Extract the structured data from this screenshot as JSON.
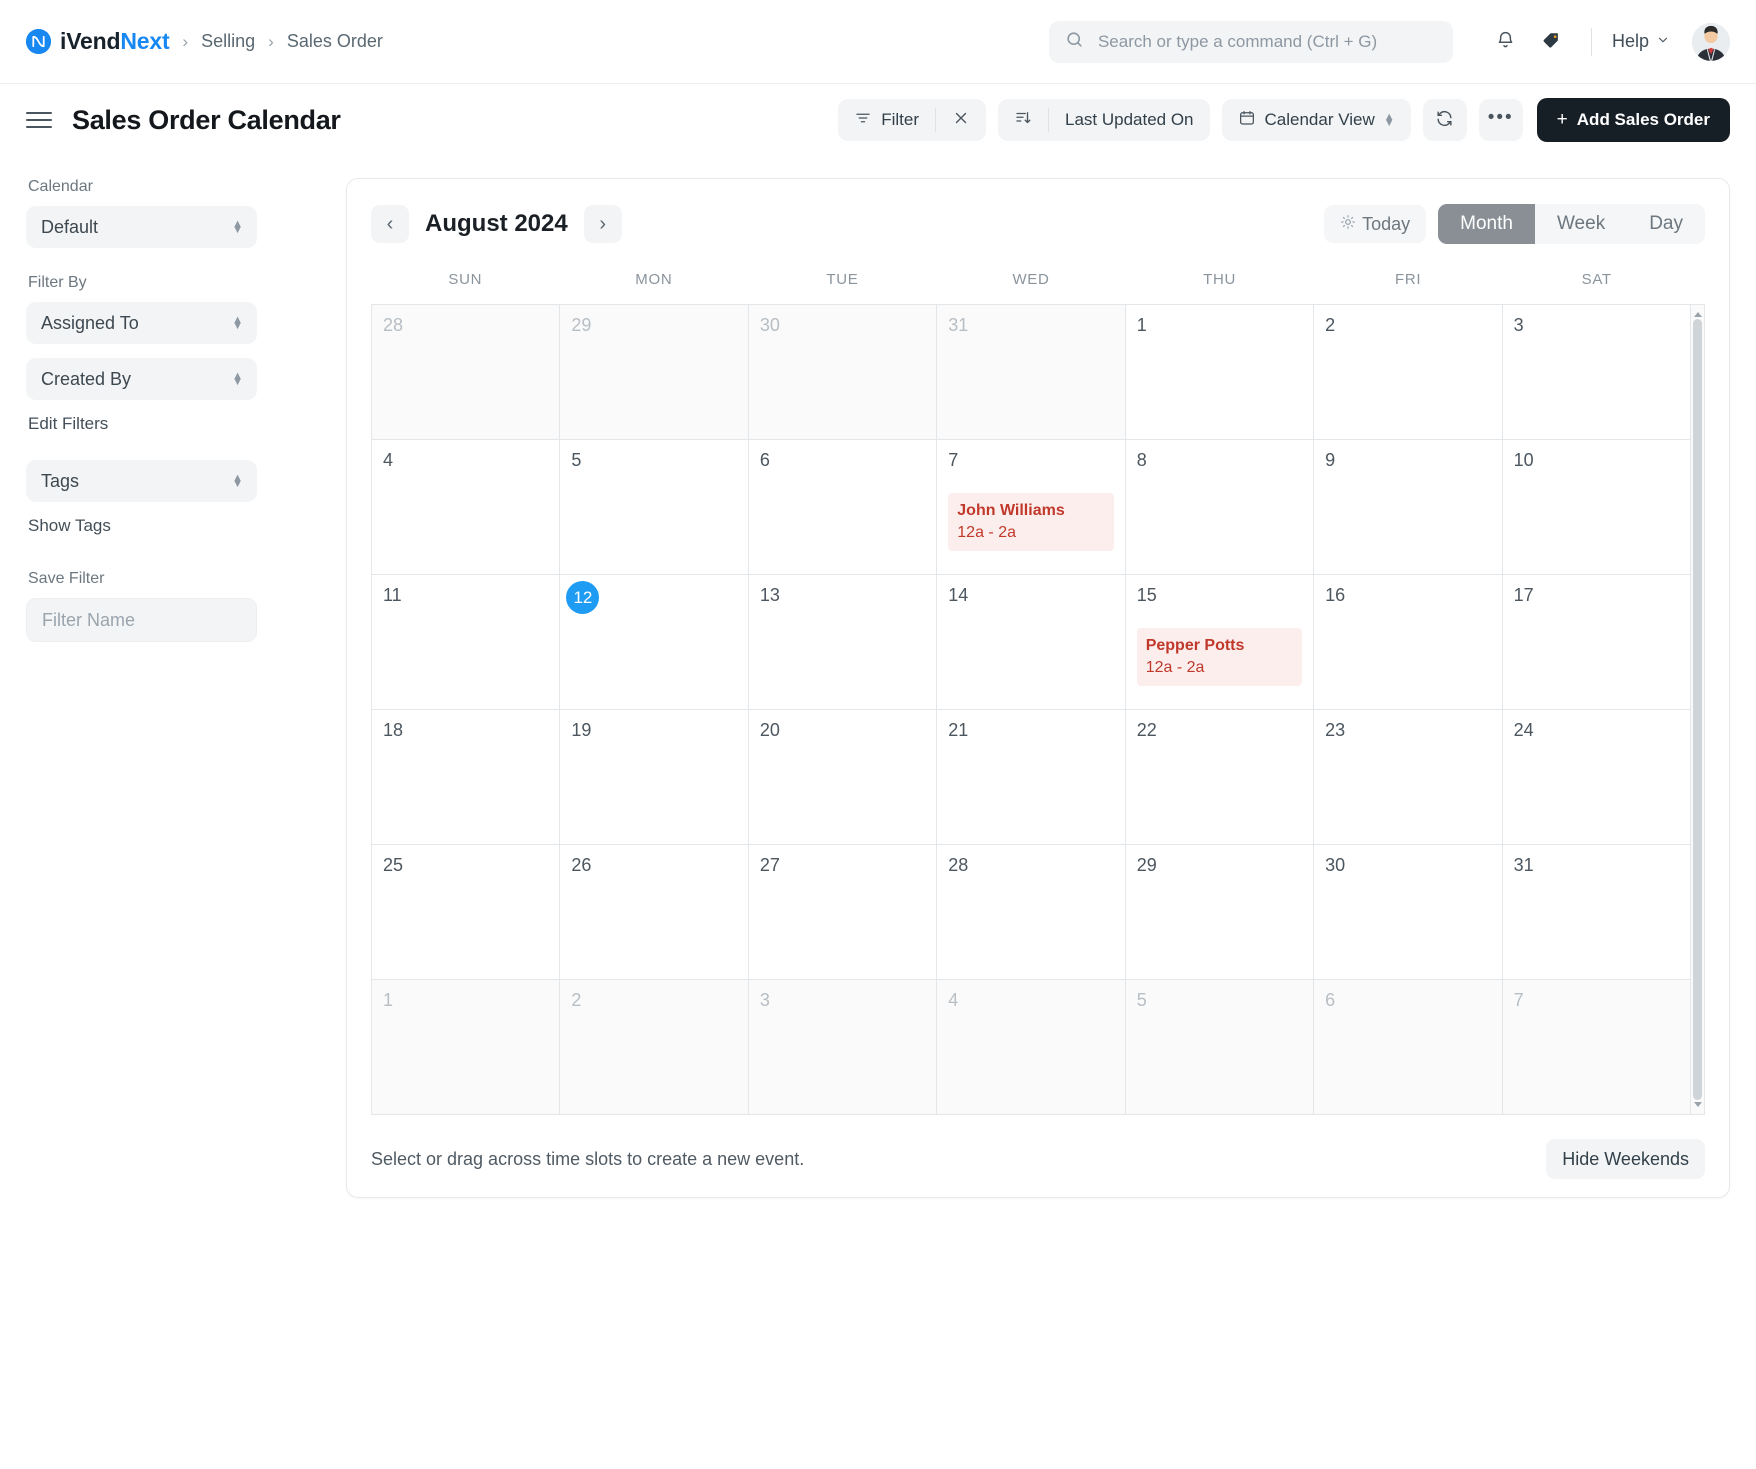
{
  "navbar": {
    "brand_first": "iVend",
    "brand_second": "Next",
    "breadcrumbs": [
      "Selling",
      "Sales Order"
    ],
    "search_placeholder": "Search or type a command (Ctrl + G)",
    "search_value": "",
    "help_label": "Help",
    "notification_icon": "bell-icon",
    "tag_icon": "tag-icon",
    "avatar_icon": "user-avatar"
  },
  "page_header": {
    "title": "Sales Order Calendar",
    "filter_label": "Filter",
    "filter_clear_label": "×",
    "sort_label": "Last Updated On",
    "view_label": "Calendar View",
    "refresh_icon": "refresh-icon",
    "more_label": "•••",
    "add_label": "Add Sales Order",
    "add_plus": "+"
  },
  "sidebar": {
    "calendar_label": "Calendar",
    "calendar_value": "Default",
    "filter_by_label": "Filter By",
    "assigned_to_value": "Assigned To",
    "created_by_value": "Created By",
    "edit_filters_label": "Edit Filters",
    "tags_value": "Tags",
    "show_tags_label": "Show Tags",
    "save_filter_label": "Save Filter",
    "filter_name_placeholder": "Filter Name",
    "filter_name_value": ""
  },
  "calendar": {
    "title": "August 2024",
    "prev_label": "‹",
    "next_label": "›",
    "today_label": "Today",
    "views": [
      {
        "label": "Month",
        "active": true
      },
      {
        "label": "Week",
        "active": false
      },
      {
        "label": "Day",
        "active": false
      }
    ],
    "weekdays": [
      "SUN",
      "MON",
      "TUE",
      "WED",
      "THU",
      "FRI",
      "SAT"
    ],
    "footer_hint": "Select or drag across time slots to create a new event.",
    "hide_weekends_label": "Hide Weekends",
    "today_date": 12,
    "accent_today_color": "#1e9cf3",
    "event_bg_color": "#fdeeee",
    "event_text_color": "#c0392b",
    "weeks": [
      [
        {
          "day": "28",
          "other": true,
          "events": []
        },
        {
          "day": "29",
          "other": true,
          "events": []
        },
        {
          "day": "30",
          "other": true,
          "events": []
        },
        {
          "day": "31",
          "other": true,
          "events": []
        },
        {
          "day": "1",
          "other": false,
          "events": []
        },
        {
          "day": "2",
          "other": false,
          "events": []
        },
        {
          "day": "3",
          "other": false,
          "events": []
        }
      ],
      [
        {
          "day": "4",
          "other": false,
          "events": []
        },
        {
          "day": "5",
          "other": false,
          "events": []
        },
        {
          "day": "6",
          "other": false,
          "events": []
        },
        {
          "day": "7",
          "other": false,
          "events": [
            {
              "name": "John Williams",
              "time": "12a - 2a"
            }
          ]
        },
        {
          "day": "8",
          "other": false,
          "events": []
        },
        {
          "day": "9",
          "other": false,
          "events": []
        },
        {
          "day": "10",
          "other": false,
          "events": []
        }
      ],
      [
        {
          "day": "11",
          "other": false,
          "events": []
        },
        {
          "day": "12",
          "other": false,
          "today": true,
          "events": []
        },
        {
          "day": "13",
          "other": false,
          "events": []
        },
        {
          "day": "14",
          "other": false,
          "events": []
        },
        {
          "day": "15",
          "other": false,
          "events": [
            {
              "name": "Pepper Potts",
              "time": "12a - 2a"
            }
          ]
        },
        {
          "day": "16",
          "other": false,
          "events": []
        },
        {
          "day": "17",
          "other": false,
          "events": []
        }
      ],
      [
        {
          "day": "18",
          "other": false,
          "events": []
        },
        {
          "day": "19",
          "other": false,
          "events": []
        },
        {
          "day": "20",
          "other": false,
          "events": []
        },
        {
          "day": "21",
          "other": false,
          "events": []
        },
        {
          "day": "22",
          "other": false,
          "events": []
        },
        {
          "day": "23",
          "other": false,
          "events": []
        },
        {
          "day": "24",
          "other": false,
          "events": []
        }
      ],
      [
        {
          "day": "25",
          "other": false,
          "events": []
        },
        {
          "day": "26",
          "other": false,
          "events": []
        },
        {
          "day": "27",
          "other": false,
          "events": []
        },
        {
          "day": "28",
          "other": false,
          "events": []
        },
        {
          "day": "29",
          "other": false,
          "events": []
        },
        {
          "day": "30",
          "other": false,
          "events": []
        },
        {
          "day": "31",
          "other": false,
          "events": []
        }
      ],
      [
        {
          "day": "1",
          "other": true,
          "events": []
        },
        {
          "day": "2",
          "other": true,
          "events": []
        },
        {
          "day": "3",
          "other": true,
          "events": []
        },
        {
          "day": "4",
          "other": true,
          "events": []
        },
        {
          "day": "5",
          "other": true,
          "events": []
        },
        {
          "day": "6",
          "other": true,
          "events": []
        },
        {
          "day": "7",
          "other": true,
          "events": []
        }
      ]
    ]
  }
}
